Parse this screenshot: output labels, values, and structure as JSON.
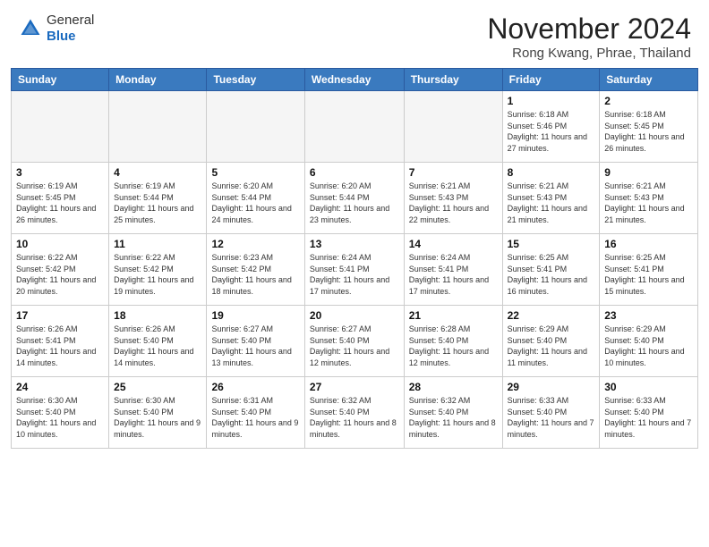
{
  "header": {
    "logo_general": "General",
    "logo_blue": "Blue",
    "month_title": "November 2024",
    "location": "Rong Kwang, Phrae, Thailand"
  },
  "days_of_week": [
    "Sunday",
    "Monday",
    "Tuesday",
    "Wednesday",
    "Thursday",
    "Friday",
    "Saturday"
  ],
  "weeks": [
    [
      {
        "day": "",
        "empty": true
      },
      {
        "day": "",
        "empty": true
      },
      {
        "day": "",
        "empty": true
      },
      {
        "day": "",
        "empty": true
      },
      {
        "day": "",
        "empty": true
      },
      {
        "day": "1",
        "sunrise": "Sunrise: 6:18 AM",
        "sunset": "Sunset: 5:46 PM",
        "daylight": "Daylight: 11 hours and 27 minutes."
      },
      {
        "day": "2",
        "sunrise": "Sunrise: 6:18 AM",
        "sunset": "Sunset: 5:45 PM",
        "daylight": "Daylight: 11 hours and 26 minutes."
      }
    ],
    [
      {
        "day": "3",
        "sunrise": "Sunrise: 6:19 AM",
        "sunset": "Sunset: 5:45 PM",
        "daylight": "Daylight: 11 hours and 26 minutes."
      },
      {
        "day": "4",
        "sunrise": "Sunrise: 6:19 AM",
        "sunset": "Sunset: 5:44 PM",
        "daylight": "Daylight: 11 hours and 25 minutes."
      },
      {
        "day": "5",
        "sunrise": "Sunrise: 6:20 AM",
        "sunset": "Sunset: 5:44 PM",
        "daylight": "Daylight: 11 hours and 24 minutes."
      },
      {
        "day": "6",
        "sunrise": "Sunrise: 6:20 AM",
        "sunset": "Sunset: 5:44 PM",
        "daylight": "Daylight: 11 hours and 23 minutes."
      },
      {
        "day": "7",
        "sunrise": "Sunrise: 6:21 AM",
        "sunset": "Sunset: 5:43 PM",
        "daylight": "Daylight: 11 hours and 22 minutes."
      },
      {
        "day": "8",
        "sunrise": "Sunrise: 6:21 AM",
        "sunset": "Sunset: 5:43 PM",
        "daylight": "Daylight: 11 hours and 21 minutes."
      },
      {
        "day": "9",
        "sunrise": "Sunrise: 6:21 AM",
        "sunset": "Sunset: 5:43 PM",
        "daylight": "Daylight: 11 hours and 21 minutes."
      }
    ],
    [
      {
        "day": "10",
        "sunrise": "Sunrise: 6:22 AM",
        "sunset": "Sunset: 5:42 PM",
        "daylight": "Daylight: 11 hours and 20 minutes."
      },
      {
        "day": "11",
        "sunrise": "Sunrise: 6:22 AM",
        "sunset": "Sunset: 5:42 PM",
        "daylight": "Daylight: 11 hours and 19 minutes."
      },
      {
        "day": "12",
        "sunrise": "Sunrise: 6:23 AM",
        "sunset": "Sunset: 5:42 PM",
        "daylight": "Daylight: 11 hours and 18 minutes."
      },
      {
        "day": "13",
        "sunrise": "Sunrise: 6:24 AM",
        "sunset": "Sunset: 5:41 PM",
        "daylight": "Daylight: 11 hours and 17 minutes."
      },
      {
        "day": "14",
        "sunrise": "Sunrise: 6:24 AM",
        "sunset": "Sunset: 5:41 PM",
        "daylight": "Daylight: 11 hours and 17 minutes."
      },
      {
        "day": "15",
        "sunrise": "Sunrise: 6:25 AM",
        "sunset": "Sunset: 5:41 PM",
        "daylight": "Daylight: 11 hours and 16 minutes."
      },
      {
        "day": "16",
        "sunrise": "Sunrise: 6:25 AM",
        "sunset": "Sunset: 5:41 PM",
        "daylight": "Daylight: 11 hours and 15 minutes."
      }
    ],
    [
      {
        "day": "17",
        "sunrise": "Sunrise: 6:26 AM",
        "sunset": "Sunset: 5:41 PM",
        "daylight": "Daylight: 11 hours and 14 minutes."
      },
      {
        "day": "18",
        "sunrise": "Sunrise: 6:26 AM",
        "sunset": "Sunset: 5:40 PM",
        "daylight": "Daylight: 11 hours and 14 minutes."
      },
      {
        "day": "19",
        "sunrise": "Sunrise: 6:27 AM",
        "sunset": "Sunset: 5:40 PM",
        "daylight": "Daylight: 11 hours and 13 minutes."
      },
      {
        "day": "20",
        "sunrise": "Sunrise: 6:27 AM",
        "sunset": "Sunset: 5:40 PM",
        "daylight": "Daylight: 11 hours and 12 minutes."
      },
      {
        "day": "21",
        "sunrise": "Sunrise: 6:28 AM",
        "sunset": "Sunset: 5:40 PM",
        "daylight": "Daylight: 11 hours and 12 minutes."
      },
      {
        "day": "22",
        "sunrise": "Sunrise: 6:29 AM",
        "sunset": "Sunset: 5:40 PM",
        "daylight": "Daylight: 11 hours and 11 minutes."
      },
      {
        "day": "23",
        "sunrise": "Sunrise: 6:29 AM",
        "sunset": "Sunset: 5:40 PM",
        "daylight": "Daylight: 11 hours and 10 minutes."
      }
    ],
    [
      {
        "day": "24",
        "sunrise": "Sunrise: 6:30 AM",
        "sunset": "Sunset: 5:40 PM",
        "daylight": "Daylight: 11 hours and 10 minutes."
      },
      {
        "day": "25",
        "sunrise": "Sunrise: 6:30 AM",
        "sunset": "Sunset: 5:40 PM",
        "daylight": "Daylight: 11 hours and 9 minutes."
      },
      {
        "day": "26",
        "sunrise": "Sunrise: 6:31 AM",
        "sunset": "Sunset: 5:40 PM",
        "daylight": "Daylight: 11 hours and 9 minutes."
      },
      {
        "day": "27",
        "sunrise": "Sunrise: 6:32 AM",
        "sunset": "Sunset: 5:40 PM",
        "daylight": "Daylight: 11 hours and 8 minutes."
      },
      {
        "day": "28",
        "sunrise": "Sunrise: 6:32 AM",
        "sunset": "Sunset: 5:40 PM",
        "daylight": "Daylight: 11 hours and 8 minutes."
      },
      {
        "day": "29",
        "sunrise": "Sunrise: 6:33 AM",
        "sunset": "Sunset: 5:40 PM",
        "daylight": "Daylight: 11 hours and 7 minutes."
      },
      {
        "day": "30",
        "sunrise": "Sunrise: 6:33 AM",
        "sunset": "Sunset: 5:40 PM",
        "daylight": "Daylight: 11 hours and 7 minutes."
      }
    ]
  ]
}
